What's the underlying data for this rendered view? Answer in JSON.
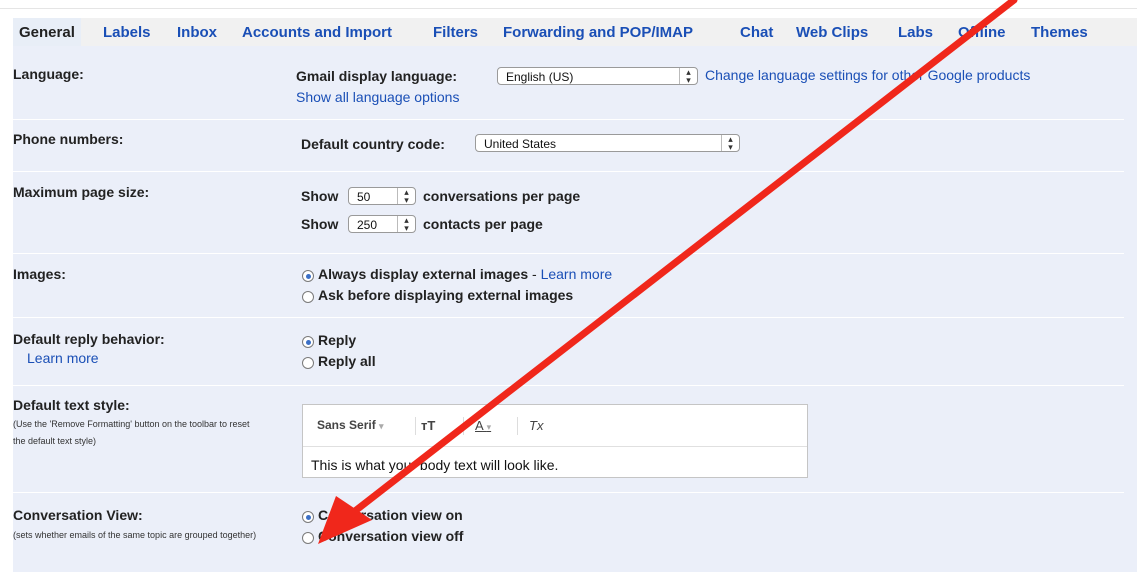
{
  "tabs": [
    "General",
    "Labels",
    "Inbox",
    "Accounts and Import",
    "Filters",
    "Forwarding and POP/IMAP",
    "Chat",
    "Web Clips",
    "Labs",
    "Offline",
    "Themes"
  ],
  "language": {
    "label": "Language:",
    "display_label": "Gmail display language:",
    "value": "English (US)",
    "change_link": "Change language settings for other Google products",
    "show_all_link": "Show all language options"
  },
  "phone": {
    "label": "Phone numbers:",
    "country_label": "Default country code:",
    "value": "United States"
  },
  "page_size": {
    "label": "Maximum page size:",
    "show": "Show",
    "conversations_value": "50",
    "conversations_suffix": "conversations per page",
    "contacts_value": "250",
    "contacts_suffix": "contacts per page"
  },
  "images": {
    "label": "Images:",
    "opt1": "Always display external images",
    "opt1_sep": " - ",
    "learn_more": "Learn more",
    "opt2": "Ask before displaying external images"
  },
  "reply": {
    "label": "Default reply behavior:",
    "learn_more": "Learn more",
    "opt1": "Reply",
    "opt2": "Reply all"
  },
  "text_style": {
    "label": "Default text style:",
    "note": "(Use the 'Remove Formatting' button on the toolbar to reset the default text style)",
    "font": "Sans Serif",
    "size_icon": "тT",
    "color_icon": "A",
    "clear_icon": "Tx",
    "sample": "This is what your body text will look like."
  },
  "conversation": {
    "label": "Conversation View:",
    "note": "(sets whether emails of the same topic are grouped together)",
    "opt1": "Conversation view on",
    "opt2": "Conversation view off"
  },
  "colors": {
    "link": "#1a4fb6",
    "panel": "#ebeff9",
    "arrow": "#f0271b"
  }
}
